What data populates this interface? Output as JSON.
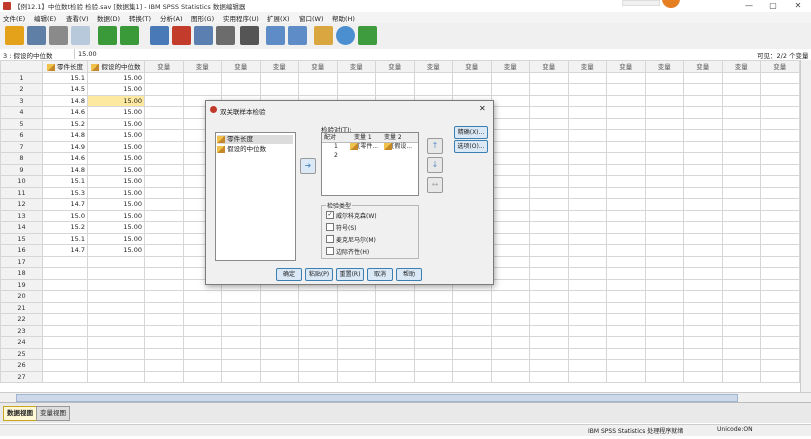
{
  "window": {
    "title": "【例12.1】中位数t检验 检验.sav [数据集1] - IBM SPSS Statistics 数据编辑器",
    "minimize": "—",
    "maximize": "▢",
    "close": "✕"
  },
  "menu": [
    "文件(E)",
    "编辑(E)",
    "查看(V)",
    "数据(D)",
    "转换(T)",
    "分析(A)",
    "图形(G)",
    "实用程序(U)",
    "扩展(X)",
    "窗口(W)",
    "帮助(H)"
  ],
  "cellinfo": {
    "ref": "3 : 假设的中位数",
    "value": "15.00",
    "visible": "可见：2/2 个变量"
  },
  "grid": {
    "col1": "零件长度",
    "col2": "假设的中位数",
    "varlabel": "变量",
    "rows": [
      [
        "1",
        "15.1",
        "15.00"
      ],
      [
        "2",
        "14.5",
        "15.00"
      ],
      [
        "3",
        "14.8",
        "15.00"
      ],
      [
        "4",
        "14.6",
        "15.00"
      ],
      [
        "5",
        "15.2",
        "15.00"
      ],
      [
        "6",
        "14.8",
        "15.00"
      ],
      [
        "7",
        "14.9",
        "15.00"
      ],
      [
        "8",
        "14.6",
        "15.00"
      ],
      [
        "9",
        "14.8",
        "15.00"
      ],
      [
        "10",
        "15.1",
        "15.00"
      ],
      [
        "11",
        "15.3",
        "15.00"
      ],
      [
        "12",
        "14.7",
        "15.00"
      ],
      [
        "13",
        "15.0",
        "15.00"
      ],
      [
        "14",
        "15.2",
        "15.00"
      ],
      [
        "15",
        "15.1",
        "15.00"
      ],
      [
        "16",
        "14.7",
        "15.00"
      ],
      [
        "17",
        "",
        ""
      ],
      [
        "18",
        "",
        ""
      ],
      [
        "19",
        "",
        ""
      ],
      [
        "20",
        "",
        ""
      ],
      [
        "21",
        "",
        ""
      ],
      [
        "22",
        "",
        ""
      ],
      [
        "23",
        "",
        ""
      ],
      [
        "24",
        "",
        ""
      ],
      [
        "25",
        "",
        ""
      ],
      [
        "26",
        "",
        ""
      ],
      [
        "27",
        "",
        ""
      ]
    ]
  },
  "tabs": {
    "data_view": "数据视图",
    "variable_view": "变量视图"
  },
  "status": {
    "processor": "IBM SPSS Statistics 处理程序就绪",
    "unicode": "Unicode:ON"
  },
  "dialog": {
    "title": "双关联样本检验",
    "close": "✕",
    "source_vars": [
      "零件长度",
      "假设的中位数"
    ],
    "pairs_label": "检验对(T):",
    "pairs_headers": [
      "配对",
      "变量 1",
      "变量 2"
    ],
    "pairs": [
      {
        "n": "1",
        "v1": "[零件...",
        "v2": "[假设..."
      },
      {
        "n": "2",
        "v1": "",
        "v2": ""
      }
    ],
    "test_type_label": "检验类型",
    "tests": [
      {
        "label": "威尔科克森(W)",
        "checked": true
      },
      {
        "label": "符号(S)",
        "checked": false
      },
      {
        "label": "麦克尼马尔(M)",
        "checked": false
      },
      {
        "label": "边际齐性(H)",
        "checked": false
      }
    ],
    "side_buttons": [
      "精确(X)...",
      "选项(O)..."
    ],
    "buttons": [
      "确定",
      "粘贴(P)",
      "重置(R)",
      "取消",
      "帮助"
    ],
    "arrow_right": "➜",
    "up": "↑",
    "down": "↓",
    "swap": "↔"
  },
  "colors": {
    "accent": "#3c7fb1",
    "selected_cell": "#fde9a0",
    "orange": "#e67e22"
  }
}
